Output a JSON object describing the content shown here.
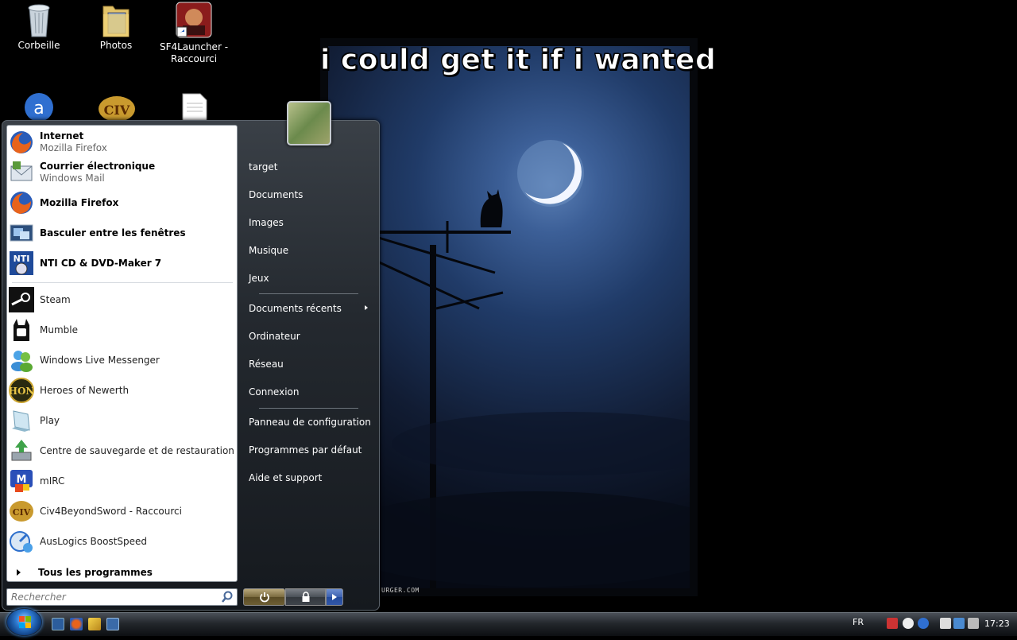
{
  "desktop": {
    "icons": [
      {
        "label": "Corbeille"
      },
      {
        "label": "Photos"
      },
      {
        "label": "SF4Launcher - Raccourci"
      }
    ],
    "wallpaper_caption": "i could get it if i wanted",
    "wallpaper_watermark": "URGER.COM"
  },
  "start_menu": {
    "pinned": [
      {
        "name": "Internet",
        "sub": "Mozilla Firefox",
        "icon": "firefox-icon"
      },
      {
        "name": "Courrier électronique",
        "sub": "Windows Mail",
        "icon": "mail-icon"
      }
    ],
    "recent": [
      {
        "name": "Mozilla Firefox",
        "icon": "firefox-icon"
      },
      {
        "name": "Basculer entre les fenêtres",
        "icon": "switch-windows-icon"
      },
      {
        "name": "NTI CD & DVD-Maker 7",
        "icon": "nti-icon"
      },
      {
        "name": "Steam",
        "icon": "steam-icon"
      },
      {
        "name": "Mumble",
        "icon": "mumble-icon"
      },
      {
        "name": "Windows Live Messenger",
        "icon": "messenger-icon"
      },
      {
        "name": "Heroes of Newerth",
        "icon": "hon-icon"
      },
      {
        "name": "Play",
        "icon": "play-icon"
      },
      {
        "name": "Centre de sauvegarde et de restauration",
        "icon": "backup-icon"
      },
      {
        "name": "mIRC",
        "icon": "mirc-icon"
      },
      {
        "name": "Civ4BeyondSword - Raccourci",
        "icon": "civ-icon"
      },
      {
        "name": "AusLogics BoostSpeed",
        "icon": "auslogics-icon"
      }
    ],
    "all_programs": "Tous les programmes",
    "search_placeholder": "Rechercher",
    "right": {
      "user": "target",
      "documents": "Documents",
      "images": "Images",
      "musique": "Musique",
      "jeux": "Jeux",
      "recent_docs": "Documents récents",
      "ordinateur": "Ordinateur",
      "reseau": "Réseau",
      "connexion": "Connexion",
      "panneau": "Panneau de configuration",
      "programmes_defaut": "Programmes par défaut",
      "aide": "Aide et support"
    }
  },
  "taskbar": {
    "language": "FR",
    "clock": "17:23"
  }
}
